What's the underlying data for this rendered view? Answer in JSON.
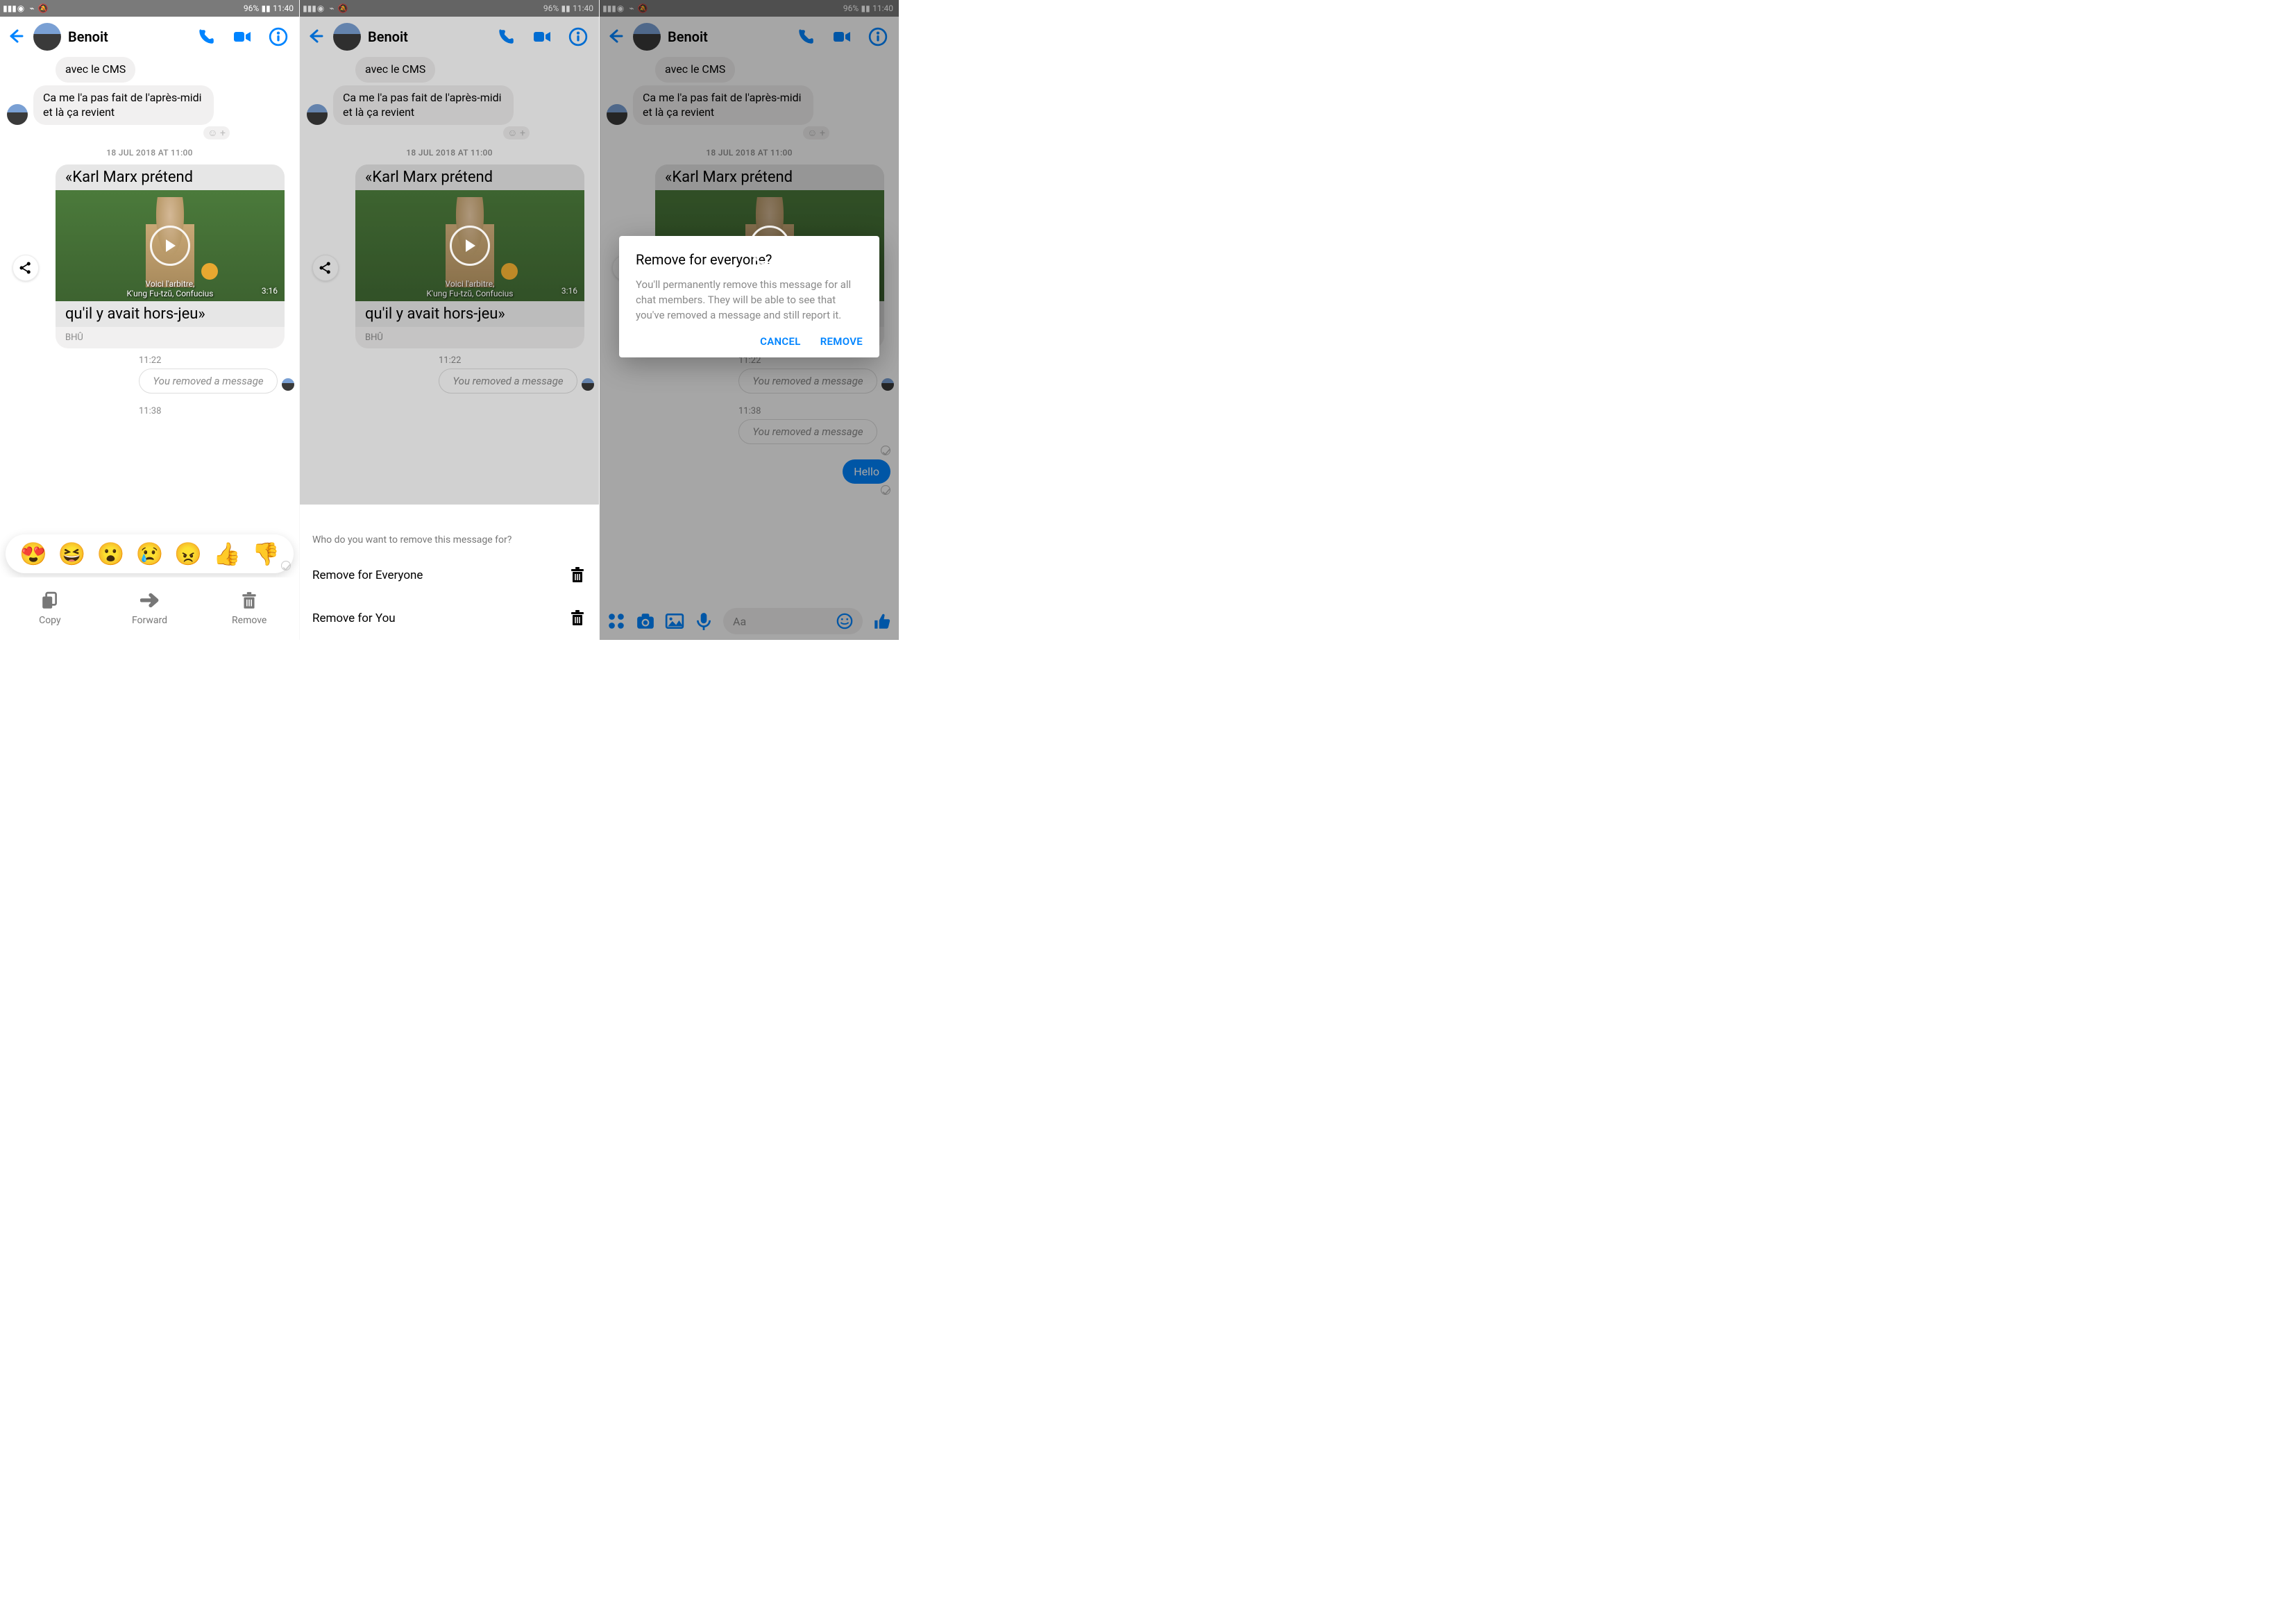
{
  "status": {
    "battery_pct": "96%",
    "time": "11:40"
  },
  "header": {
    "contact_name": "Benoit"
  },
  "messages": {
    "in1": "avec le CMS",
    "in2": "Ca me l'a pas fait de l'après-midi et là ça revient",
    "timestamp1": "18 JUL 2018 AT 11:00",
    "card_title_top": "«Karl Marx prétend",
    "card_title_bottom": "qu'il y avait hors-jeu»",
    "card_caption_l1": "Voici l'arbitre,",
    "card_caption_l2": "K'ung Fu-tzŭ, Confucius",
    "card_duration": "3:16",
    "card_source": "BHÛ",
    "time_1122": "11:22",
    "removed_text": "You removed a message",
    "time_1138": "11:38",
    "out_hello": "Hello"
  },
  "composer": {
    "placeholder": "Aa"
  },
  "reactions": {
    "love": "😍",
    "haha": "😆",
    "wow": "😮",
    "sad": "😢",
    "angry": "😠",
    "up": "👍",
    "down": "👎"
  },
  "actions": {
    "copy": "Copy",
    "forward": "Forward",
    "remove": "Remove"
  },
  "sheet": {
    "prompt": "Who do you want to remove this message for?",
    "opt_everyone": "Remove for Everyone",
    "opt_you": "Remove for You"
  },
  "dialog": {
    "title": "Remove for everyone?",
    "body": "You'll permanently remove this message for all chat members. They will be able to see that you've removed a message and still report it.",
    "cancel": "CANCEL",
    "remove": "REMOVE"
  }
}
